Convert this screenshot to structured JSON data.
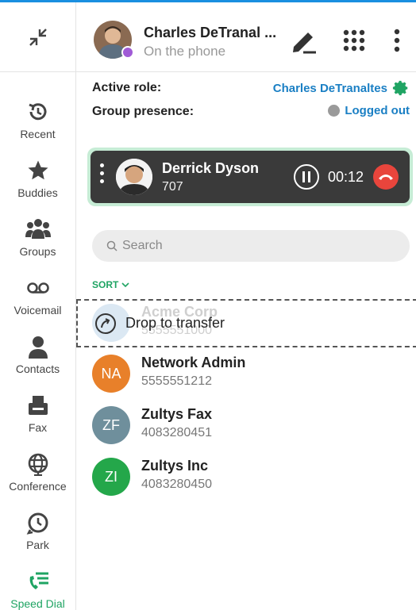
{
  "user": {
    "name": "Charles DeTranal ...",
    "status": "On the phone"
  },
  "role": {
    "active_role_label": "Active role:",
    "active_role_value": "Charles DeTranaltes",
    "group_presence_label": "Group presence:",
    "group_presence_value": "Logged out"
  },
  "active_call": {
    "name": "Derrick Dyson",
    "extension": "707",
    "timer": "00:12"
  },
  "search": {
    "placeholder": "Search"
  },
  "sort_label": "SORT",
  "drop_label": "Drop to transfer",
  "contacts": [
    {
      "initials": "",
      "name": "Acme Corp",
      "phone": "5555551000",
      "color": "#dbe8f3"
    },
    {
      "initials": "NA",
      "name": "Network Admin",
      "phone": "5555551212",
      "color": "#e8802a"
    },
    {
      "initials": "ZF",
      "name": "Zultys Fax",
      "phone": "4083280451",
      "color": "#6f8f9c"
    },
    {
      "initials": "ZI",
      "name": "Zultys Inc",
      "phone": "4083280450",
      "color": "#24a74a"
    }
  ],
  "nav": [
    {
      "label": "Recent",
      "icon": "clock-history-icon"
    },
    {
      "label": "Buddies",
      "icon": "star-icon"
    },
    {
      "label": "Groups",
      "icon": "group-icon"
    },
    {
      "label": "Voicemail",
      "icon": "voicemail-icon"
    },
    {
      "label": "Contacts",
      "icon": "person-icon"
    },
    {
      "label": "Fax",
      "icon": "fax-icon"
    },
    {
      "label": "Conference",
      "icon": "globe-icon"
    },
    {
      "label": "Park",
      "icon": "park-clock-icon"
    },
    {
      "label": "Speed Dial",
      "icon": "speed-dial-icon"
    }
  ],
  "colors": {
    "accent_green": "#1fa463",
    "link_blue": "#1a7fc4",
    "hangup_red": "#e8453c",
    "presence_purple": "#a05bd6"
  }
}
